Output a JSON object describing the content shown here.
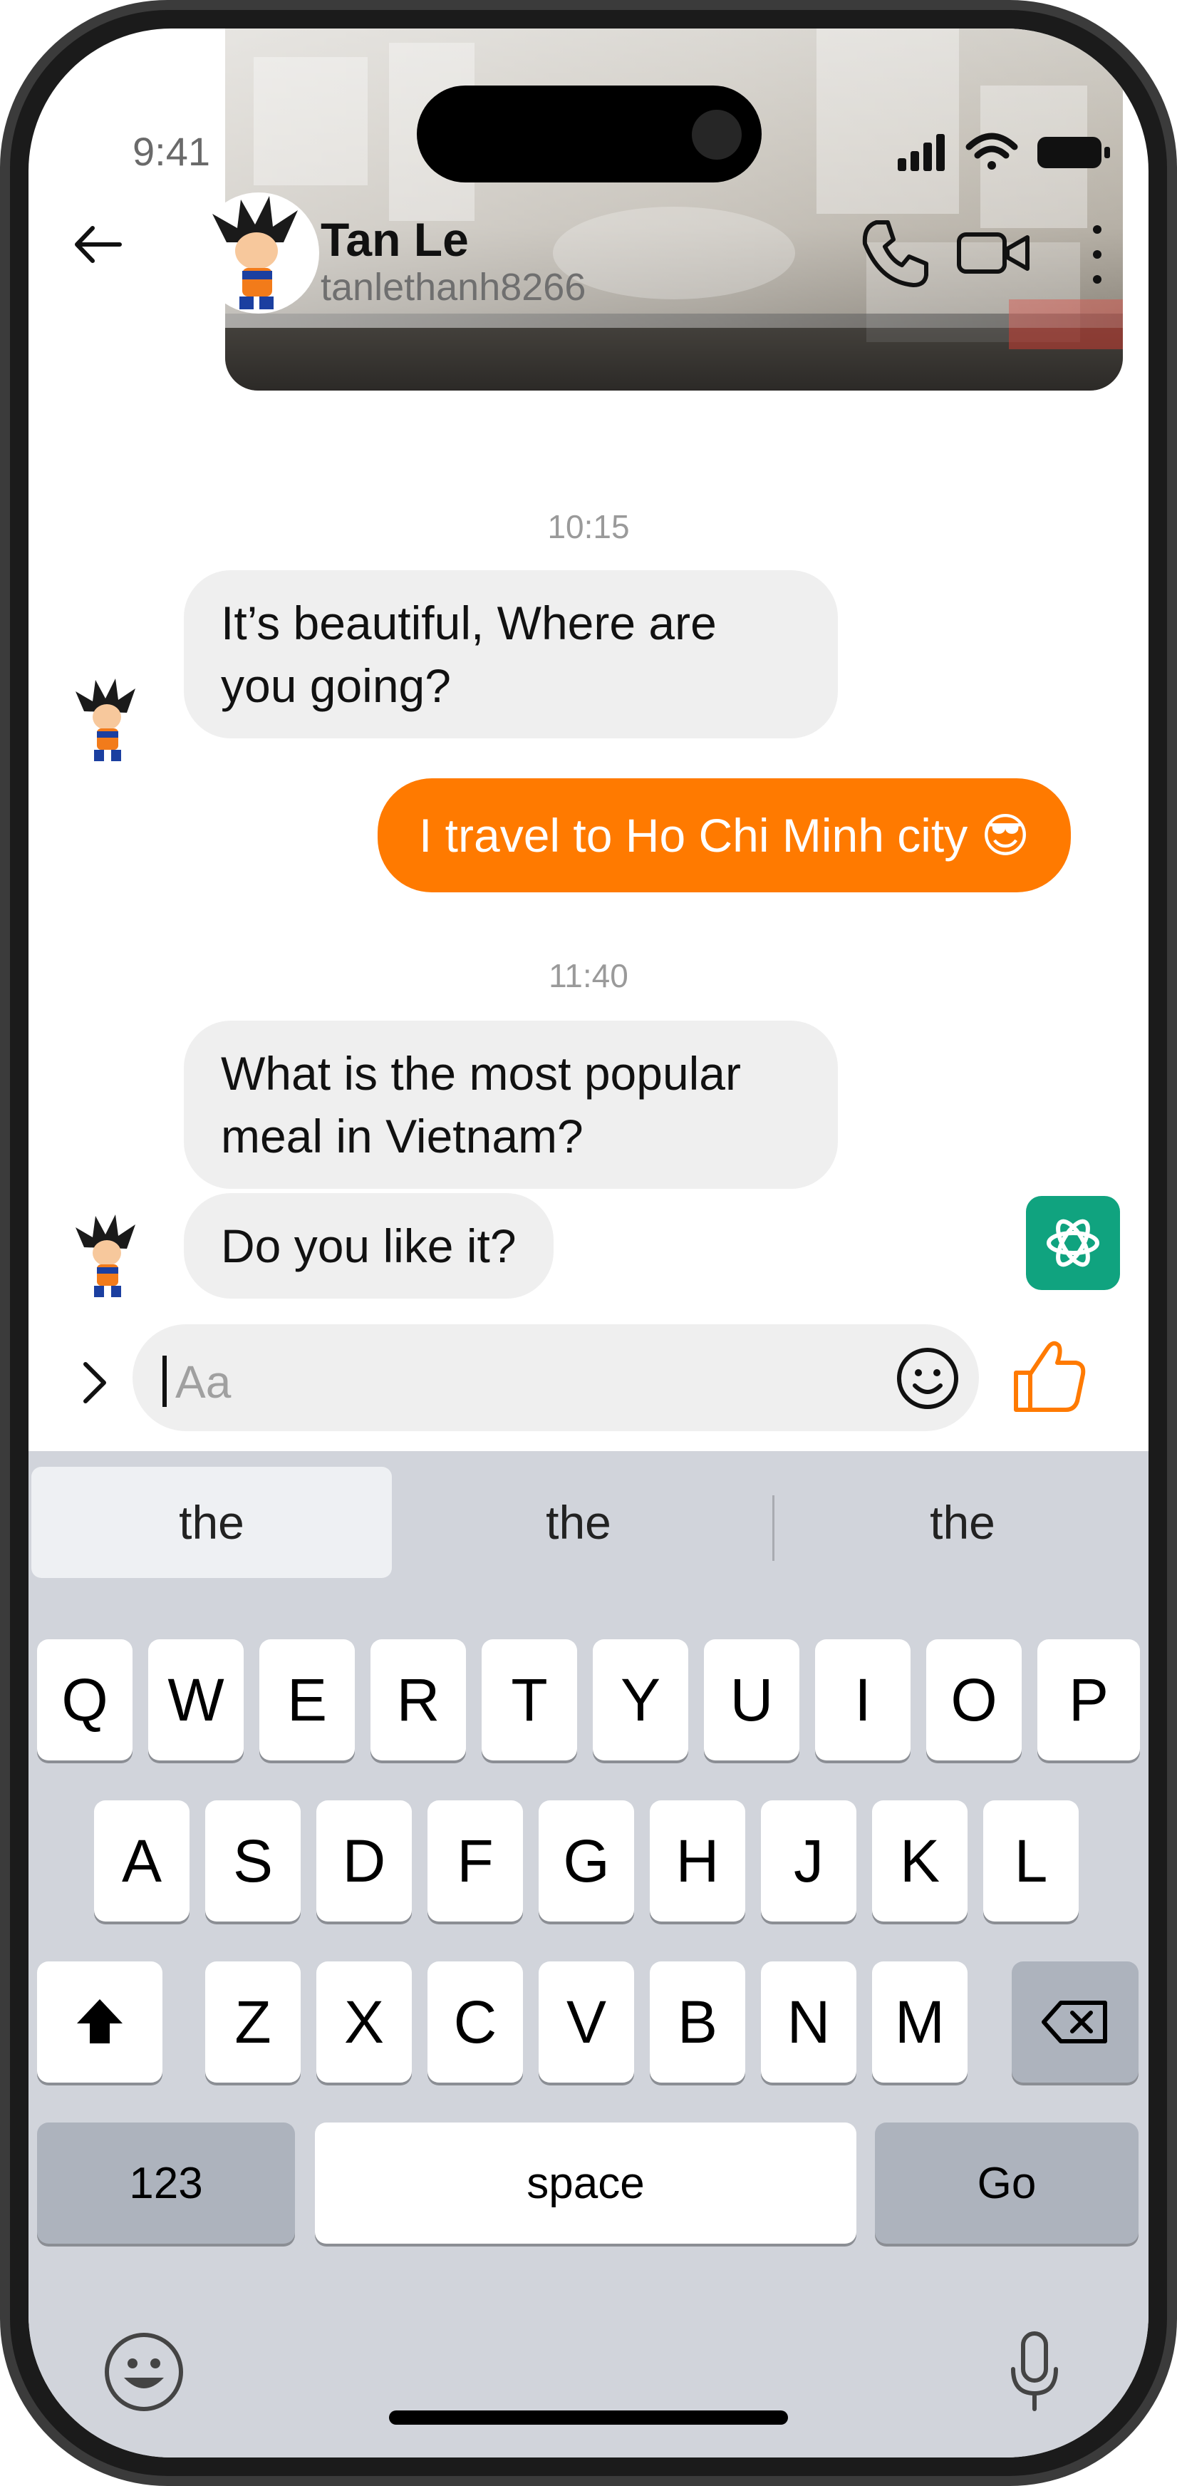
{
  "status_bar": {
    "time": "9:41",
    "icons": [
      "cellular-signal-icon",
      "wifi-icon",
      "battery-icon"
    ]
  },
  "header": {
    "contact_name": "Tan Le",
    "contact_username": "tanlethanh8266",
    "actions": [
      "back-arrow-icon",
      "phone-icon",
      "video-camera-icon",
      "more-vertical-icon"
    ]
  },
  "chat": {
    "timestamp_1": "10:15",
    "msg_1": "It’s beautiful, Where are you going?",
    "msg_2": "I travel to Ho Chi Minh city 😎",
    "timestamp_2": "11:40",
    "msg_3": "What is the most popular meal in Vietnam?",
    "msg_4": "Do you like it?"
  },
  "composer": {
    "placeholder": "Aa",
    "icons": [
      "chevron-right-icon",
      "smiley-icon",
      "thumbs-up-icon",
      "chatgpt-icon"
    ]
  },
  "keyboard": {
    "suggestions": [
      "the",
      "the",
      "the"
    ],
    "row1": [
      "Q",
      "W",
      "E",
      "R",
      "T",
      "Y",
      "U",
      "I",
      "O",
      "P"
    ],
    "row2": [
      "A",
      "S",
      "D",
      "F",
      "G",
      "H",
      "J",
      "K",
      "L"
    ],
    "row3": [
      "Z",
      "X",
      "C",
      "V",
      "B",
      "N",
      "M"
    ],
    "numbers_label": "123",
    "space_label": "space",
    "go_label": "Go"
  },
  "colors": {
    "accent": "#ff7a00",
    "incoming_bubble": "#efefef",
    "gpt_green": "#10a37f",
    "keyboard_bg": "#d1d4db"
  }
}
